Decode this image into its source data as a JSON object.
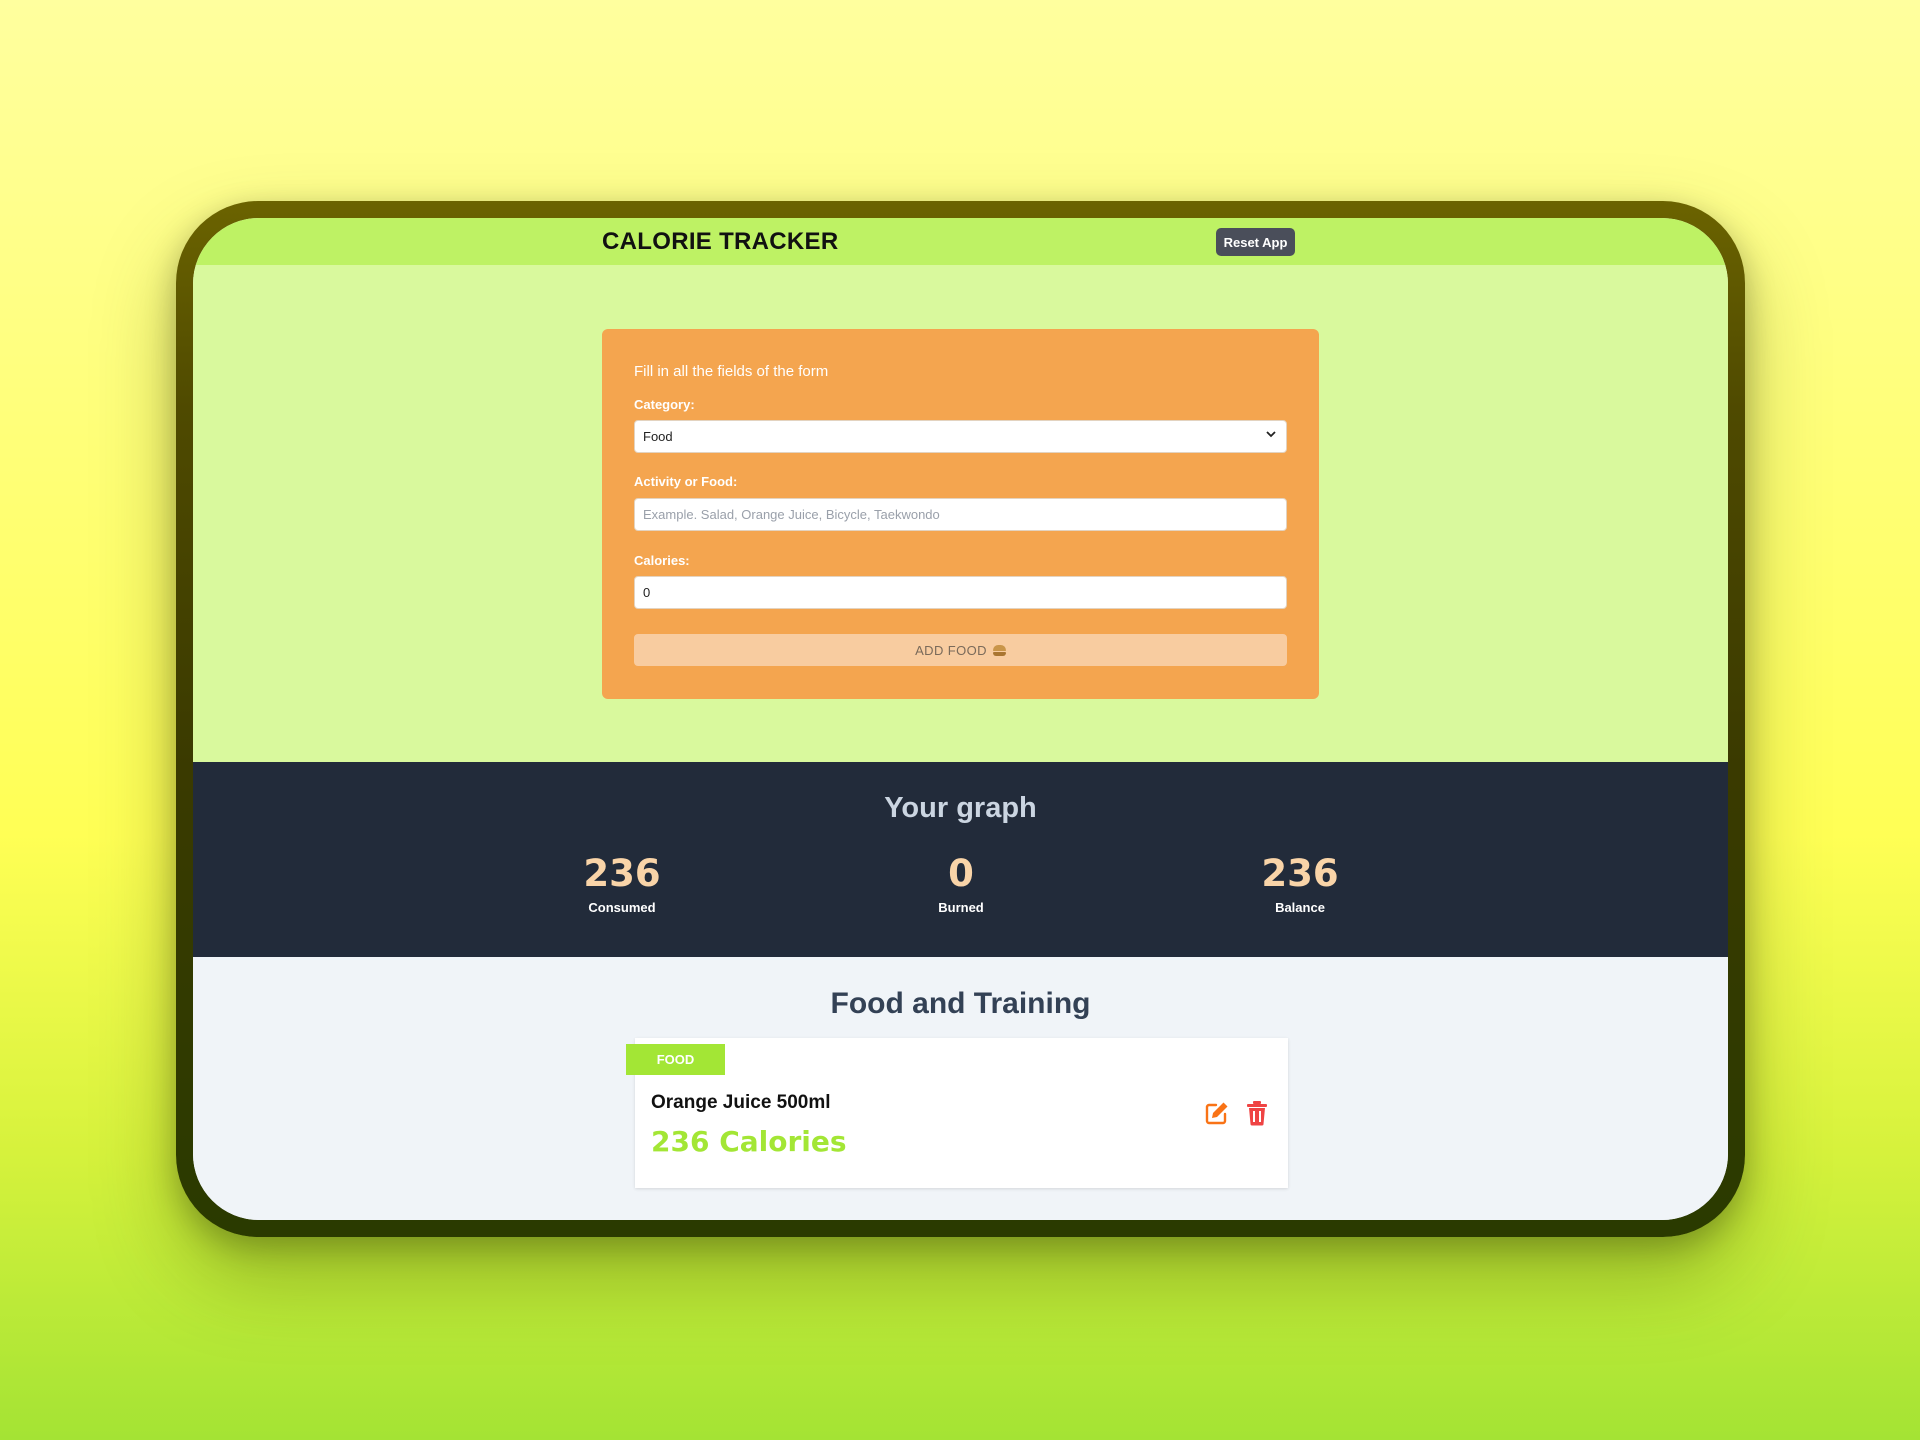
{
  "header": {
    "title": "CALORIE TRACKER",
    "reset_label": "Reset App"
  },
  "form": {
    "intro": "Fill in all the fields of the form",
    "category_label": "Category:",
    "category_value": "Food",
    "activity_label": "Activity or Food:",
    "activity_placeholder": "Example. Salad, Orange Juice, Bicycle, Taekwondo",
    "calories_label": "Calories:",
    "calories_value": "0",
    "submit_label": "ADD FOOD"
  },
  "graph": {
    "title": "Your graph",
    "stats": [
      {
        "value": "236",
        "label": "Consumed"
      },
      {
        "value": "0",
        "label": "Burned"
      },
      {
        "value": "236",
        "label": "Balance"
      }
    ]
  },
  "list": {
    "title": "Food and Training",
    "items": [
      {
        "category": "FOOD",
        "name": "Orange Juice 500ml",
        "calories": "236 Calories"
      }
    ]
  },
  "colors": {
    "header_bg": "#bef264",
    "form_bg": "#d9f99d",
    "card_bg": "#f4a54f",
    "graph_bg": "#222b3a",
    "accent_green": "#a3e635",
    "stat_number": "#f9d4a8",
    "edit_icon": "#f97316",
    "delete_icon": "#ef4444"
  },
  "icons": {
    "add_button": "burger-icon",
    "edit": "edit-icon",
    "delete": "trash-icon"
  }
}
